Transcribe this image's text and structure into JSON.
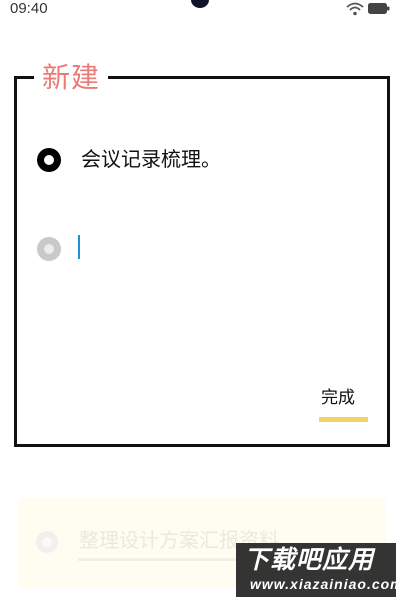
{
  "status_bar": {
    "time": "09:40",
    "wifi_icon": "wifi-icon",
    "battery_icon": "battery-icon"
  },
  "dialog": {
    "title": "新建",
    "title_color": "#e97a77",
    "tasks": [
      {
        "text": "会议记录梳理。",
        "state": "filled"
      }
    ],
    "new_task": {
      "value": "",
      "placeholder": ""
    },
    "done_label": "完成",
    "done_accent_color": "#f3d46a"
  },
  "background_list": {
    "items": [
      {
        "text": "整理设计方案汇报资料"
      }
    ]
  },
  "watermark": {
    "main": "下载吧应用",
    "sub": "www.xiazainiao.com"
  }
}
